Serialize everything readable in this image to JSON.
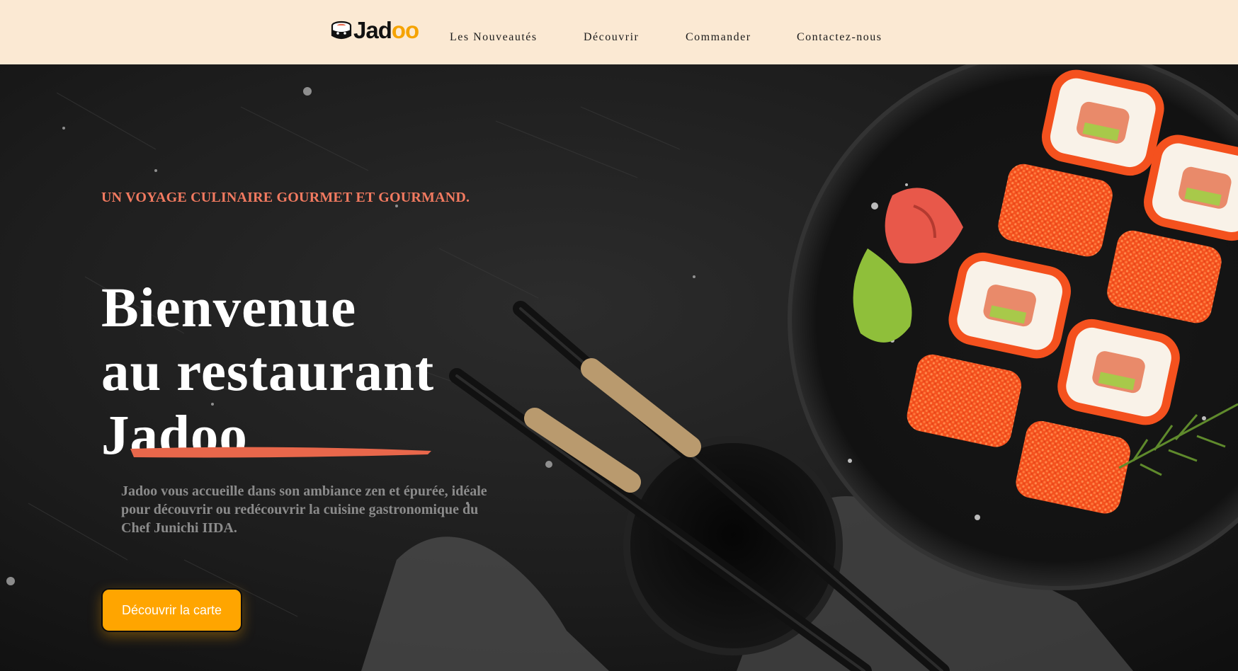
{
  "brand": {
    "name_main": "Jad",
    "name_accent": "oo",
    "accent_color": "#f5a300"
  },
  "nav": {
    "items": [
      {
        "label": "Les Nouveautés"
      },
      {
        "label": "Découvrir"
      },
      {
        "label": "Commander"
      },
      {
        "label": "Contactez-nous"
      }
    ]
  },
  "hero": {
    "tagline": "UN VOYAGE CULINAIRE GOURMET ET GOURMAND.",
    "title_line1": "Bienvenue",
    "title_line2": "au restaurant",
    "title_line3": "Jadoo",
    "description": "Jadoo vous accueille dans son ambiance zen et épurée, idéale pour découvrir ou redécouvrir la cuisine gastronomique du Chef Junichi IIDA.",
    "cta_label": "Découvrir la carte",
    "image_icon": "sushi-platter-image"
  },
  "colors": {
    "header_bg": "#fbe9d3",
    "tagline": "#f27a60",
    "cta": "#ffa500",
    "underline": "#e8674b"
  }
}
